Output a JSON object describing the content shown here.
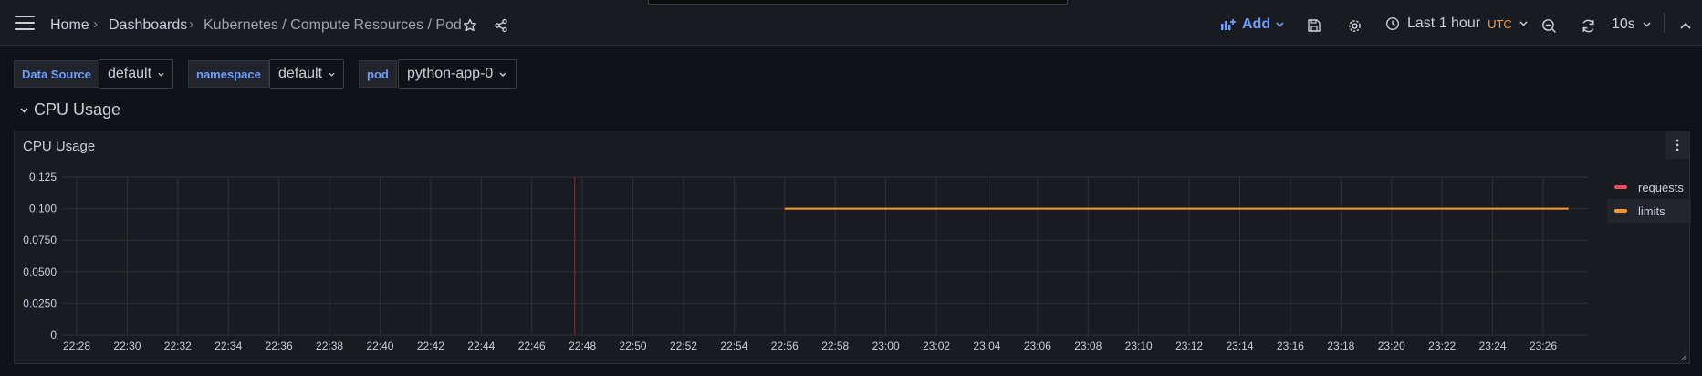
{
  "breadcrumb": {
    "home": "Home",
    "dashboards": "Dashboards",
    "current": "Kubernetes / Compute Resources / Pod"
  },
  "toolbar": {
    "add_label": "Add",
    "time_range": "Last 1 hour",
    "timezone": "UTC",
    "refresh_interval": "10s"
  },
  "variables": [
    {
      "label": "Data Source",
      "value": "default"
    },
    {
      "label": "namespace",
      "value": "default"
    },
    {
      "label": "pod",
      "value": "python-app-0"
    }
  ],
  "row": {
    "title": "CPU Usage"
  },
  "panel": {
    "title": "CPU Usage",
    "legend": [
      {
        "name": "requests",
        "color": "#f2495c"
      },
      {
        "name": "limits",
        "color": "#ff9830"
      }
    ]
  },
  "chart_data": {
    "type": "line",
    "title": "CPU Usage",
    "xlabel": "",
    "ylabel": "",
    "ylim": [
      0,
      0.125
    ],
    "yticks": [
      "0",
      "0.0250",
      "0.0500",
      "0.0750",
      "0.100",
      "0.125"
    ],
    "xticks": [
      "22:28",
      "22:30",
      "22:32",
      "22:34",
      "22:36",
      "22:38",
      "22:40",
      "22:42",
      "22:44",
      "22:46",
      "22:48",
      "22:50",
      "22:52",
      "22:54",
      "22:56",
      "22:58",
      "23:00",
      "23:02",
      "23:04",
      "23:06",
      "23:08",
      "23:10",
      "23:12",
      "23:14",
      "23:16",
      "23:18",
      "23:20",
      "23:22",
      "23:24",
      "23:26"
    ],
    "grid": true,
    "legend_position": "right",
    "annotation_time": "22:47.7",
    "series": [
      {
        "name": "requests",
        "color": "#f2495c",
        "points": []
      },
      {
        "name": "limits",
        "color": "#ff9830",
        "points": [
          [
            "22:56",
            0.1
          ],
          [
            "23:27",
            0.1
          ]
        ]
      }
    ]
  }
}
